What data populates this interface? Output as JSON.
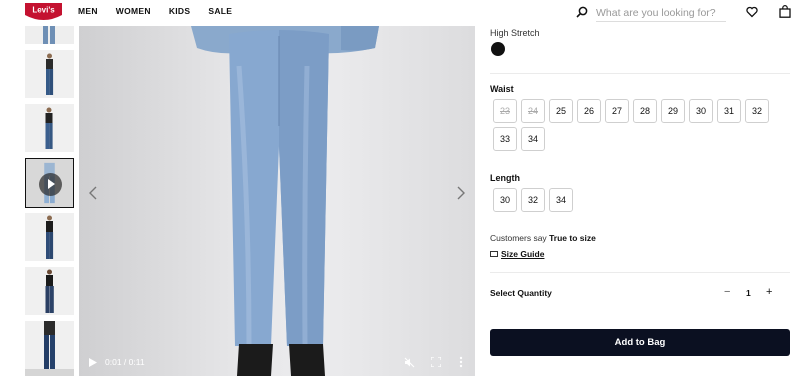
{
  "header": {
    "logo_text": "Levi's",
    "nav": [
      "MEN",
      "WOMEN",
      "KIDS",
      "SALE"
    ],
    "search_placeholder": "What are you looking for?"
  },
  "gallery": {
    "thumbnail_count": 7,
    "active_thumbnail": 4,
    "video": {
      "time": "0:01 / 0:11"
    }
  },
  "product": {
    "stretch_label": "High Stretch",
    "swatch_color": "#111111",
    "waist": {
      "title": "Waist",
      "sizes": [
        {
          "label": "23",
          "available": false
        },
        {
          "label": "24",
          "available": false
        },
        {
          "label": "25",
          "available": true
        },
        {
          "label": "26",
          "available": true
        },
        {
          "label": "27",
          "available": true
        },
        {
          "label": "28",
          "available": true
        },
        {
          "label": "29",
          "available": true
        },
        {
          "label": "30",
          "available": true
        },
        {
          "label": "31",
          "available": true
        },
        {
          "label": "32",
          "available": true
        },
        {
          "label": "33",
          "available": true
        },
        {
          "label": "34",
          "available": true
        }
      ]
    },
    "length": {
      "title": "Length",
      "sizes": [
        "30",
        "32",
        "34"
      ]
    },
    "fit": {
      "prefix": "Customers say",
      "value": "True to size"
    },
    "size_guide": "Size Guide",
    "quantity": {
      "label": "Select Quantity",
      "minus": "−",
      "value": "1",
      "plus": "+"
    },
    "add_to_bag": "Add to Bag"
  },
  "colors": {
    "brand_red": "#c41230",
    "button_dark": "#0b1021"
  }
}
